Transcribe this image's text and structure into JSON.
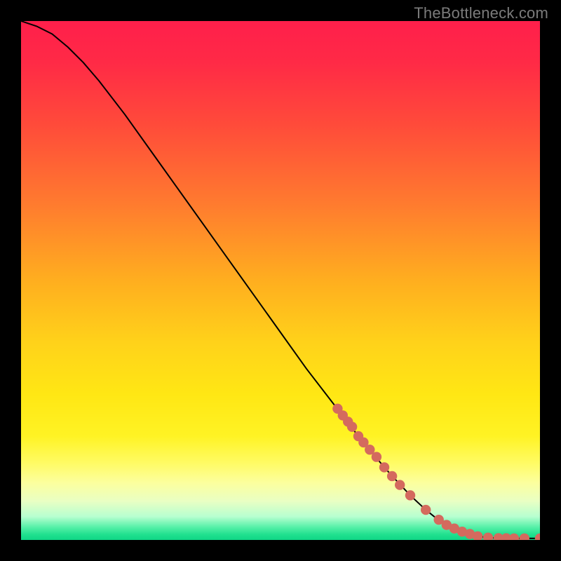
{
  "watermark": "TheBottleneck.com",
  "colors": {
    "gradient_stops": [
      {
        "offset": 0.0,
        "color": "#ff1f4b"
      },
      {
        "offset": 0.08,
        "color": "#ff2a46"
      },
      {
        "offset": 0.2,
        "color": "#ff4b3a"
      },
      {
        "offset": 0.35,
        "color": "#ff7a2f"
      },
      {
        "offset": 0.5,
        "color": "#ffae1f"
      },
      {
        "offset": 0.62,
        "color": "#ffd21a"
      },
      {
        "offset": 0.72,
        "color": "#ffe714"
      },
      {
        "offset": 0.8,
        "color": "#fff324"
      },
      {
        "offset": 0.85,
        "color": "#fffb62"
      },
      {
        "offset": 0.89,
        "color": "#fcff9e"
      },
      {
        "offset": 0.925,
        "color": "#e9ffc3"
      },
      {
        "offset": 0.955,
        "color": "#b7ffd0"
      },
      {
        "offset": 0.975,
        "color": "#57f0a8"
      },
      {
        "offset": 0.99,
        "color": "#1fe08e"
      },
      {
        "offset": 1.0,
        "color": "#10d686"
      }
    ],
    "curve": "#000000",
    "marker_fill": "#d46a5e",
    "marker_stroke": "#c55a50"
  },
  "chart_data": {
    "type": "line",
    "title": "",
    "xlabel": "",
    "ylabel": "",
    "xlim": [
      0,
      100
    ],
    "ylim": [
      0,
      100
    ],
    "series": [
      {
        "name": "bottleneck-curve",
        "x": [
          0,
          3,
          6,
          9,
          12,
          15,
          20,
          25,
          30,
          35,
          40,
          45,
          50,
          55,
          60,
          65,
          70,
          72,
          75,
          78,
          80,
          83,
          86,
          88,
          90,
          92,
          94,
          96,
          98,
          100
        ],
        "y": [
          100,
          99,
          97.5,
          95,
          92,
          88.5,
          82,
          75,
          68,
          61,
          54,
          47,
          40,
          33,
          26.5,
          20,
          14,
          11.8,
          8.6,
          5.8,
          4.2,
          2.4,
          1.2,
          0.7,
          0.45,
          0.35,
          0.3,
          0.3,
          0.3,
          0.3
        ]
      }
    ],
    "markers": {
      "name": "highlight-points",
      "x": [
        61,
        62,
        63,
        63.8,
        65,
        66,
        67.2,
        68.5,
        70,
        71.5,
        73,
        75,
        78,
        80.5,
        82,
        83.5,
        85,
        86.5,
        88,
        90,
        92,
        93.5,
        95,
        97,
        100
      ],
      "y": [
        25.3,
        24,
        22.8,
        21.8,
        20,
        18.8,
        17.4,
        16,
        14,
        12.3,
        10.6,
        8.6,
        5.8,
        3.9,
        2.9,
        2.2,
        1.6,
        1.15,
        0.7,
        0.45,
        0.35,
        0.32,
        0.3,
        0.3,
        0.3
      ]
    }
  }
}
